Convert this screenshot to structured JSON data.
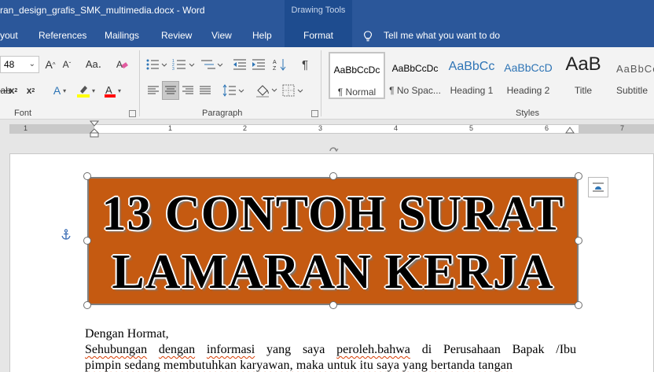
{
  "titlebar": {
    "title": "ran_design_grafis_SMK_multimedia.docx  -  Word",
    "contextual_group": "Drawing Tools"
  },
  "tabs": [
    {
      "label": "yout"
    },
    {
      "label": "References"
    },
    {
      "label": "Mailings"
    },
    {
      "label": "Review"
    },
    {
      "label": "View"
    },
    {
      "label": "Help"
    },
    {
      "label": "Format"
    }
  ],
  "tell_me": {
    "label": "Tell me what you want to do",
    "icon": "lightbulb-icon"
  },
  "ribbon": {
    "font_size": "48",
    "groups": {
      "font": "Font",
      "paragraph": "Paragraph",
      "styles": "Styles"
    },
    "styles": [
      {
        "preview": "AaBbCcDc",
        "name": "¶ Normal"
      },
      {
        "preview": "AaBbCcDc",
        "name": "¶ No Spac..."
      },
      {
        "preview": "AaBbCc",
        "name": "Heading 1"
      },
      {
        "preview": "AaBbCcD",
        "name": "Heading 2"
      },
      {
        "preview": "AaB",
        "name": "Title"
      },
      {
        "preview": "AaBbCc",
        "name": "Subtitle"
      }
    ],
    "accent_color": "#2b579a",
    "highlight_color": "#ffff00",
    "font_color": "#ff0000"
  },
  "ruler": {
    "numbers": [
      "1",
      "1",
      "2",
      "3",
      "4",
      "5",
      "6",
      "7"
    ]
  },
  "document": {
    "banner_line1": "13 CONTOH SURAT",
    "banner_line2": "LAMARAN KERJA",
    "banner_color": "#c55a11",
    "greeting": "Dengan Hormat,",
    "para_line1_words": [
      "Sehubungan",
      "dengan",
      "informasi",
      "yang",
      "saya",
      "peroleh.bahwa",
      "di",
      "Perusahaan",
      "Bapak",
      "/Ibu"
    ],
    "para_line2": "pimpin sedang membutuhkan karyawan, maka untuk itu saya yang bertanda tangan"
  }
}
